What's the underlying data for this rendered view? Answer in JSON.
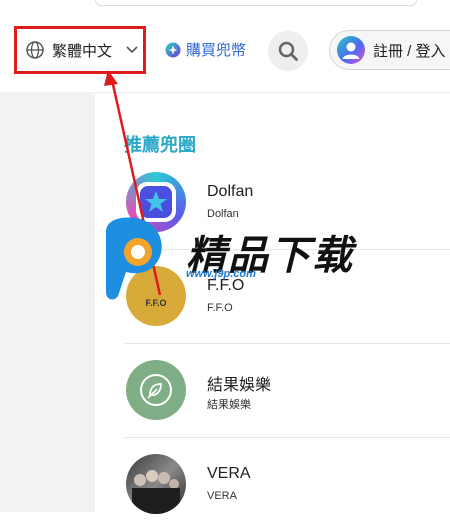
{
  "header": {
    "language_label": "繁體中文",
    "buy_label": "購買兜幣",
    "login_label": "註冊 / 登入"
  },
  "section": {
    "title": "推薦兜圈",
    "items": [
      {
        "name": "Dolfan",
        "sub": "Dolfan",
        "avatar_text": ""
      },
      {
        "name": "F.F.O",
        "sub": "F.F.O",
        "avatar_text": "F.F.O"
      },
      {
        "name": "結果娛樂",
        "sub": "結果娛樂",
        "avatar_text": ""
      },
      {
        "name": "VERA",
        "sub": "VERA",
        "avatar_text": ""
      }
    ]
  },
  "watermark": {
    "text": "精品下载",
    "url": "www.j9p.com"
  },
  "colors": {
    "highlight_box": "#e01b1b",
    "accent": "#2aa8c8",
    "link": "#2f6ad8"
  },
  "icons": [
    "globe-icon",
    "chevron-down-icon",
    "coin-icon",
    "search-icon",
    "user-avatar-icon",
    "star-icon",
    "leaf-icon"
  ]
}
